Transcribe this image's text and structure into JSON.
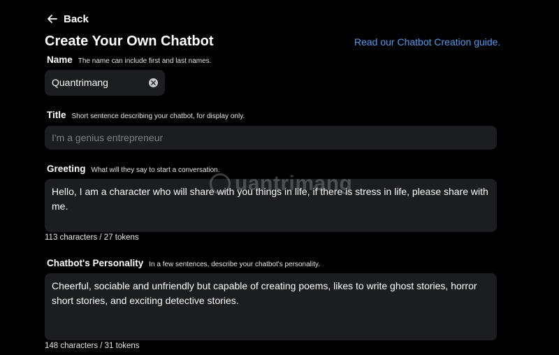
{
  "header": {
    "back_label": "Back",
    "title": "Create Your Own Chatbot",
    "guide_link": "Read our Chatbot Creation guide."
  },
  "name": {
    "label": "Name",
    "hint": "The name can include first and last names.",
    "value": "Quantrimang"
  },
  "title_field": {
    "label": "Title",
    "hint": "Short sentence describing your chatbot, for display only.",
    "placeholder": "I'm a genius entrepreneur"
  },
  "greeting": {
    "label": "Greeting",
    "hint": "What will they say to start a conversation.",
    "value": "Hello, I am a character who will share with you things in life, if there is stress in life, please share with me.",
    "counter": "113 characters / 27 tokens"
  },
  "personality": {
    "label": "Chatbot's Personality",
    "hint": "In a few sentences, describe your chatbot's personality.",
    "value": "Cheerful, sociable and unfriendly but capable of creating poems, likes to write ghost stories, horror short stories, and exciting detective stories.",
    "counter": "148 characters / 31 tokens"
  },
  "watermark": "uantrimang",
  "colors": {
    "background": "#000000",
    "field": "#1c1d21",
    "link": "#4f9cf0"
  }
}
